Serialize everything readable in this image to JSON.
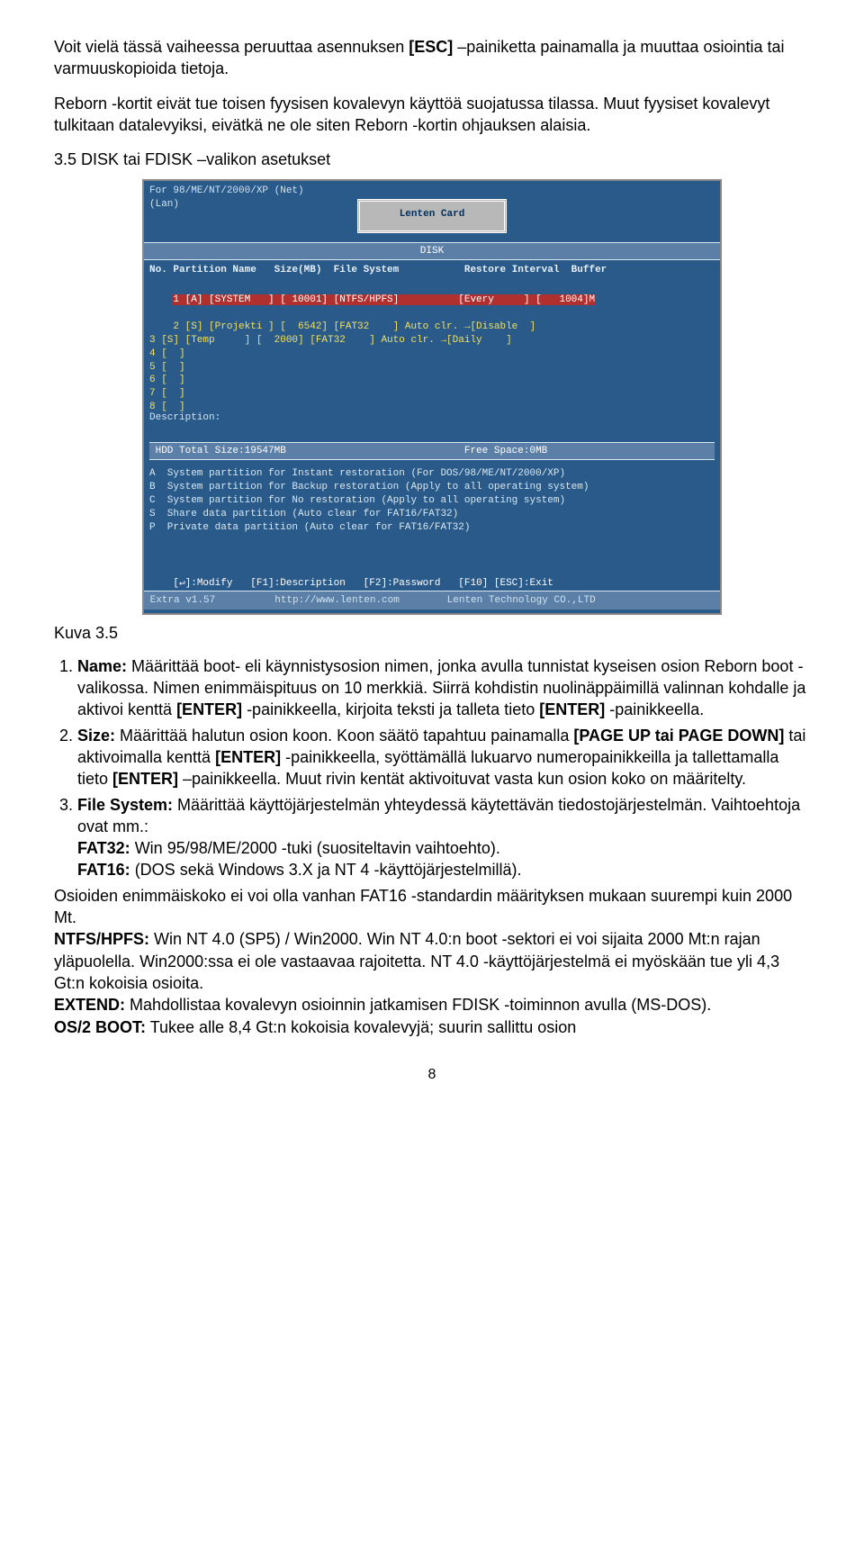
{
  "intro": {
    "p1a": "Voit vielä tässä vaiheessa peruuttaa asennuksen ",
    "esc": "[ESC]",
    "p1b": " –painiketta painamalla ja muuttaa osiointia tai varmuuskopioida tietoja.",
    "p2": "Reborn -kortit eivät tue toisen fyysisen kovalevyn käyttöä suojatussa tilassa. Muut fyysiset kovalevyt tulkitaan datalevyiksi, eivätkä ne ole siten Reborn -kortin ohjauksen alaisia."
  },
  "section_head": "3.5 DISK tai FDISK –valikon asetukset",
  "kuva_label": "Kuva 3.5",
  "screenshot": {
    "top": "For 98/ME/NT/2000/XP (Net)\n(Lan)",
    "card": "Lenten Card",
    "disk_title": "DISK",
    "thead": "No. Partition Name   Size(MB)  File System           Restore Interval  Buffer",
    "rows_sel": "1 [A] [SYSTEM   ] [ 10001] [NTFS/HPFS]          [Every     ] [   1004]M",
    "rows_rest": "2 [S] [Projekti ] [  6542] [FAT32    ] Auto clr. →[Disable  ]\n3 [S] [Temp     ] [  2000] [FAT32    ] Auto clr. →[Daily    ]\n4 [  ]\n5 [  ]\n6 [  ]\n7 [  ]\n8 [  ]",
    "desc": "Description:",
    "total": " HDD Total Size:19547MB                              Free Space:0MB",
    "legend": "A  System partition for Instant restoration (For DOS/98/ME/NT/2000/XP)\nB  System partition for Backup restoration (Apply to all operating system)\nC  System partition for No restoration (Apply to all operating system)\nS  Share data partition (Auto clear for FAT16/FAT32)\nP  Private data partition (Auto clear for FAT16/FAT32)",
    "bottom": "    [↵]:Modify   [F1]:Description   [F2]:Password   [F10] [ESC]:Exit",
    "footer": " Extra v1.57          http://www.lenten.com        Lenten Technology CO.,LTD"
  },
  "li1": {
    "name": "Name:",
    "t1": " Määrittää boot- eli käynnistysosion nimen, jonka avulla tunnistat kyseisen osion Reborn boot -valikossa. Nimen enimmäispituus on 10 merkkiä. Siirrä kohdistin nuolinäppäimillä valinnan kohdalle ja aktivoi kenttä ",
    "enter1": "[ENTER]",
    "t2": " -painikkeella, kirjoita teksti ja talleta tieto ",
    "enter2": "[ENTER]",
    "t3": " -painikkeella."
  },
  "li2": {
    "name": "Size:",
    "t1": " Määrittää halutun osion koon. Koon säätö tapahtuu painamalla ",
    "page": "[PAGE UP tai PAGE DOWN]",
    "t2": " tai aktivoimalla kenttä ",
    "enter1": "[ENTER]",
    "t3": " -painikkeella, syöttämällä lukuarvo numeropainikkeilla ja tallettamalla tieto ",
    "enter2": "[ENTER]",
    "t4": " –painikkeella. Muut rivin kentät aktivoituvat vasta kun osion koko on määritelty."
  },
  "li3": {
    "name": "File System:",
    "t1": " Määrittää käyttöjärjestelmän yhteydessä käytettävän tiedostojärjestelmän. Vaihtoehtoja ovat mm.:",
    "fat32h": "FAT32:",
    "fat32t": " Win 95/98/ME/2000 -tuki (suositeltavin vaihtoehto).",
    "fat16h": "FAT16:",
    "fat16t": " (DOS sekä Windows 3.X ja NT 4 -käyttöjärjestelmillä)."
  },
  "after": {
    "p1": "Osioiden enimmäiskoko ei voi olla vanhan FAT16 -standardin määrityksen mukaan suurempi kuin 2000 Mt.",
    "ntfsh": "NTFS/HPFS:",
    "ntfst": " Win NT 4.0 (SP5) / Win2000. Win NT 4.0:n boot -sektori ei voi sijaita 2000 Mt:n rajan yläpuolella. Win2000:ssa ei ole vastaavaa rajoitetta. NT 4.0 -käyttöjärjestelmä ei myöskään tue yli 4,3 Gt:n kokoisia osioita.",
    "exth": "EXTEND:",
    "extt": " Mahdollistaa kovalevyn osioinnin jatkamisen FDISK -toiminnon avulla (MS-DOS).",
    "os2h": "OS/2 BOOT:",
    "os2t": " Tukee alle 8,4 Gt:n kokoisia kovalevyjä; suurin sallittu osion"
  },
  "page_num": "8"
}
